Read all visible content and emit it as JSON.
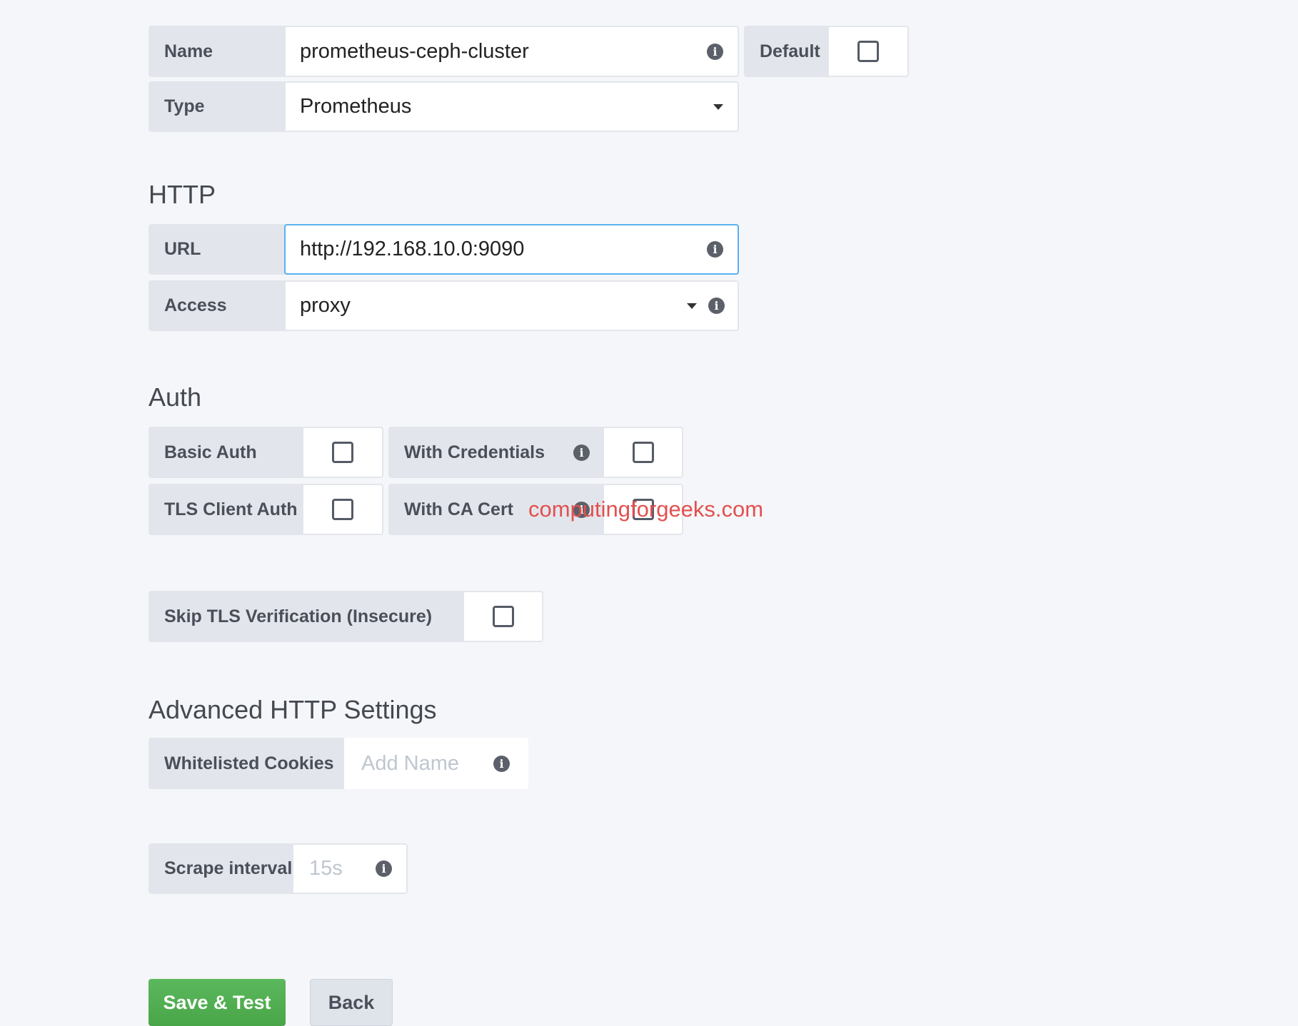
{
  "name_row": {
    "label": "Name",
    "value": "prometheus-ceph-cluster",
    "default_label": "Default",
    "default_checked": false
  },
  "type_row": {
    "label": "Type",
    "value": "Prometheus"
  },
  "http": {
    "heading": "HTTP",
    "url_label": "URL",
    "url_value": "http://192.168.10.0:9090",
    "access_label": "Access",
    "access_value": "proxy"
  },
  "auth": {
    "heading": "Auth",
    "basic_auth_label": "Basic Auth",
    "with_credentials_label": "With Credentials",
    "tls_client_auth_label": "TLS Client Auth",
    "with_ca_cert_label": "With CA Cert",
    "skip_tls_label": "Skip TLS Verification (Insecure)"
  },
  "advanced": {
    "heading": "Advanced HTTP Settings",
    "cookies_label": "Whitelisted Cookies",
    "cookies_placeholder": "Add Name"
  },
  "scrape": {
    "label": "Scrape interval",
    "placeholder": "15s"
  },
  "buttons": {
    "save": "Save & Test",
    "back": "Back"
  },
  "watermark": "computingforgeeks.com",
  "icons": {
    "info": "info-icon",
    "caret": "caret-down-icon",
    "checkbox": "checkbox-icon"
  },
  "colors": {
    "primary": "#5cb85c",
    "focus": "#5ab1ee",
    "watermark": "#e2504f"
  }
}
